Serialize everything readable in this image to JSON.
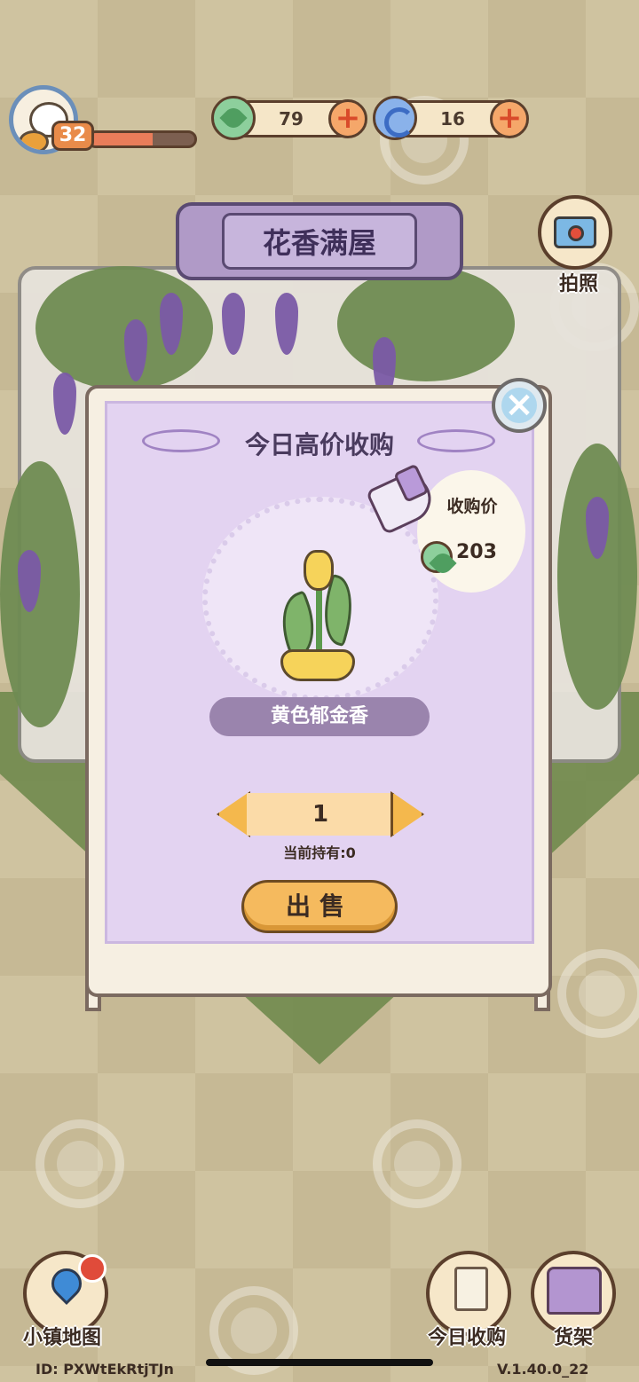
{
  "hud": {
    "level": "32",
    "xp_progress": 0.6,
    "leaf_currency": "79",
    "swirl_currency": "16",
    "plus_symbol": "+",
    "camera_label": "拍照"
  },
  "scene": {
    "title": "花香满屋"
  },
  "modal": {
    "title": "今日高价收购",
    "close_symbol": "×",
    "price_label": "收购价",
    "price_value": "203",
    "item_name": "黄色郁金香",
    "quantity": "1",
    "owned_text": "当前持有:0",
    "sell_label": "出售"
  },
  "bottom": {
    "map_label": "小镇地图",
    "purchase_label": "今日收购",
    "shelf_label": "货架",
    "player_id": "ID: PXWtEkRtjTJn",
    "version": "V.1.40.0_22"
  },
  "colors": {
    "modal_bg": "#e3d3f1",
    "sell_button": "#f5ba5e",
    "name_plate": "#9a84ad"
  }
}
